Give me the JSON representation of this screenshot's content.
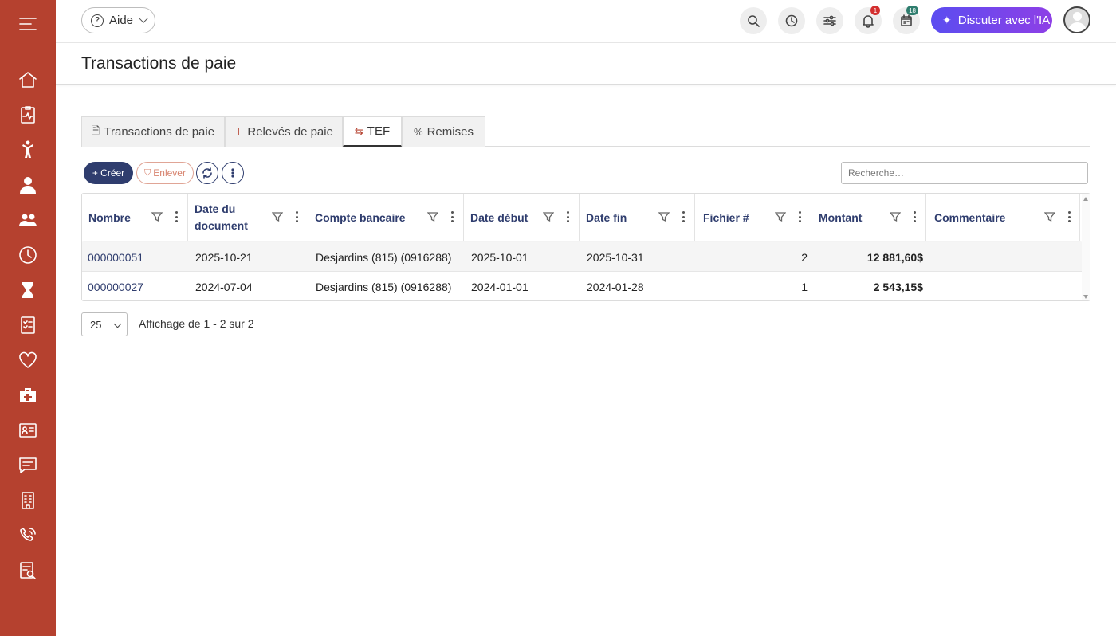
{
  "header": {
    "help_label": "Aide",
    "ai_label": "Discuter avec l'IA",
    "notifications_badge": "1",
    "calendar_badge": "18"
  },
  "page": {
    "title": "Transactions de paie"
  },
  "tabs": [
    {
      "label": "Transactions de paie",
      "icon": "document-icon"
    },
    {
      "label": "Relevés de paie",
      "icon": "stamp-icon"
    },
    {
      "label": "TEF",
      "icon": "transfer-icon"
    },
    {
      "label": "Remises",
      "icon": "percent-icon"
    }
  ],
  "toolbar": {
    "create_label": "+ Créer",
    "remove_label": "Enlever",
    "search_placeholder": "Recherche…"
  },
  "table": {
    "columns": [
      "Nombre",
      "Date du document",
      "Compte bancaire",
      "Date début",
      "Date fin",
      "Fichier #",
      "Montant",
      "Commentaire"
    ],
    "rows": [
      {
        "nombre": "000000051",
        "date_doc": "2025-10-21",
        "compte": "Desjardins (815) (0916288)",
        "date_debut": "2025-10-01",
        "date_fin": "2025-10-31",
        "fichier": "2",
        "montant": "12 881,60$",
        "commentaire": ""
      },
      {
        "nombre": "000000027",
        "date_doc": "2024-07-04",
        "compte": "Desjardins (815) (0916288)",
        "date_debut": "2024-01-01",
        "date_fin": "2024-01-28",
        "fichier": "1",
        "montant": "2 543,15$",
        "commentaire": ""
      }
    ]
  },
  "pagination": {
    "page_size": "25",
    "info": "Affichage de 1 - 2 sur 2"
  },
  "colors": {
    "sidebar": "#b5412f",
    "primary": "#2f3d6e",
    "accent_gradient_start": "#5b4df0",
    "accent_gradient_end": "#8e3fe6"
  }
}
